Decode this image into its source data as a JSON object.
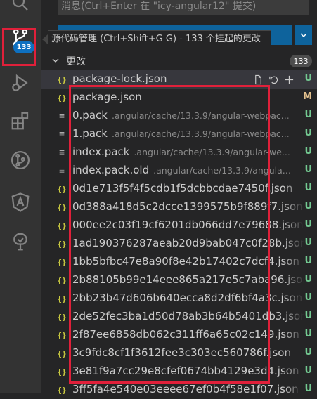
{
  "commit_message_placeholder": "消息(Ctrl+Enter 在 \"icy-angular12\" 提交)",
  "tooltip_text": "源代码管理 (Ctrl+Shift+G G) - 133 个挂起的更改",
  "scm_badge": "133",
  "changes": {
    "label": "更改",
    "count": "133"
  },
  "files": [
    {
      "icon": "{}",
      "name": "package-lock.json",
      "path": "",
      "status": "U"
    },
    {
      "icon": "{}",
      "name": "package.json",
      "path": "",
      "status": "M"
    },
    {
      "icon": "≡",
      "name": "0.pack",
      "path": ".angular/cache/13.3.9/angular-webpac...",
      "status": "U"
    },
    {
      "icon": "≡",
      "name": "1.pack",
      "path": ".angular/cache/13.3.9/angular-webpac...",
      "status": "U"
    },
    {
      "icon": "≡",
      "name": "index.pack",
      "path": ".angular/cache/13.3.9/angular-we...",
      "status": "U"
    },
    {
      "icon": "≡",
      "name": "index.pack.old",
      "path": ".angular/cache/13.3.9/angula...",
      "status": "U"
    },
    {
      "icon": "{}",
      "name": "0d1e713f5f4f5cdb1f5dcbbcdae7450f.json",
      "path": "",
      "status": "U"
    },
    {
      "icon": "{}",
      "name": "0d388a418d5c2dcce1399575b9f889f7.json",
      "path": "",
      "status": "U"
    },
    {
      "icon": "{}",
      "name": "000ee2c03f19cf6201db066dd7e79688.json",
      "path": "",
      "status": "U"
    },
    {
      "icon": "{}",
      "name": "1ad190376287aeab20d9bab047c0f28b.json",
      "path": "",
      "status": "U"
    },
    {
      "icon": "{}",
      "name": "1bb5bfbc47e8a90f8e42b17402c7dcf4.json",
      "path": "",
      "status": "U"
    },
    {
      "icon": "{}",
      "name": "2b88105b99e14eee865a217e5c7aba96.json",
      "path": "",
      "status": "U"
    },
    {
      "icon": "{}",
      "name": "2bb23b47d606b640ecca8d2df6bf4a3c.json",
      "path": "",
      "status": "U"
    },
    {
      "icon": "{}",
      "name": "2de52fec3ba1d50d78ab3b64b5401db3.json",
      "path": "",
      "status": "U"
    },
    {
      "icon": "{}",
      "name": "2f87ee6858db062c311ff6a65c02c149.json",
      "path": "",
      "status": "U"
    },
    {
      "icon": "{}",
      "name": "3c9fdc8cf1f3612fee3c303ec560786f.json",
      "path": "",
      "status": "U"
    },
    {
      "icon": "{}",
      "name": "3e81f9a7cc29e8cfef0674bb4129e3d4.json",
      "path": "",
      "status": "U"
    },
    {
      "icon": "{}",
      "name": "3ff5fa4e540e03eeee67ef0b4f58e1f07.json",
      "path": "",
      "status": "U"
    }
  ]
}
